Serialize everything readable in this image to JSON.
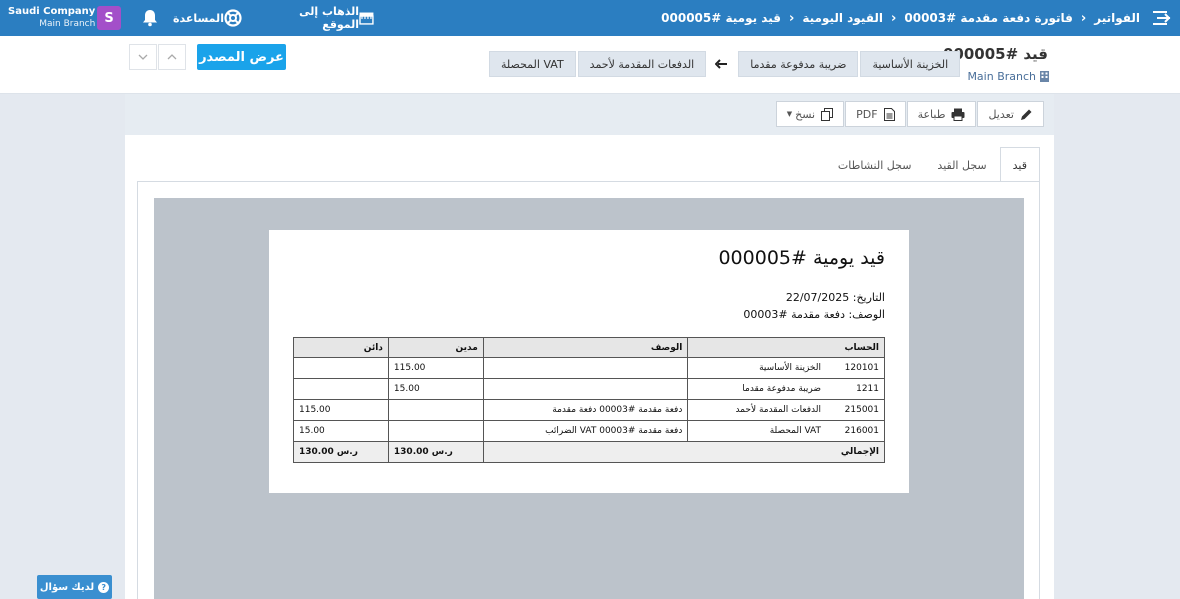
{
  "topbar": {
    "breadcrumbs": [
      "الفواتير",
      "فاتورة دفعة مقدمة #00003",
      "القيود اليومية",
      "قيد يومية #000005"
    ],
    "company_name": "Saudi Company",
    "company_branch": "Main Branch",
    "avatar_letter": "S",
    "help_label": "المساعدة",
    "visit_site_label": "الذهاب إلى الموقع"
  },
  "header": {
    "entry_title": "قيد #000005",
    "branch": "Main Branch",
    "tags": [
      "الخزينة الأساسية",
      "ضريبة مدفوعة مقدما",
      "الدفعات المقدمة لأحمد",
      "VAT المحصلة"
    ],
    "view_source_label": "عرض المصدر"
  },
  "toolbar": {
    "edit_label": "تعديل",
    "print_label": "طباعة",
    "pdf_label": "PDF",
    "copy_label": "نسخ"
  },
  "tabs": [
    "قيد",
    "سجل القيد",
    "سجل النشاطات"
  ],
  "document": {
    "title": "قيد يومية #000005",
    "date_label": "التاريخ:",
    "date_value": "22/07/2025",
    "desc_label": "الوصف:",
    "desc_value": "دفعة مقدمة #00003",
    "columns": [
      "الحساب",
      "الوصف",
      "مدين",
      "دائن"
    ],
    "rows": [
      {
        "code": "120101",
        "account": "الخزينة الأساسية",
        "desc": "",
        "debit": "115.00",
        "credit": ""
      },
      {
        "code": "1211",
        "account": "ضريبة مدفوعة مقدما",
        "desc": "",
        "debit": "15.00",
        "credit": ""
      },
      {
        "code": "215001",
        "account": "الدفعات المقدمة لأحمد",
        "desc": "دفعة مقدمة #00003 دفعة مقدمة",
        "debit": "",
        "credit": "115.00"
      },
      {
        "code": "216001",
        "account": "VAT المحصلة",
        "desc": "دفعة مقدمة #00003 VAT الضرائب",
        "debit": "",
        "credit": "15.00"
      }
    ],
    "total_label": "الإجمالي",
    "total_debit": "130.00 ر.س",
    "total_credit": "130.00 ر.س"
  },
  "ask_question_label": "لديك سؤال",
  "colors": {
    "topbar": "#2b7ec1",
    "accent": "#1aa3ea",
    "avatar": "#a34fc9"
  }
}
